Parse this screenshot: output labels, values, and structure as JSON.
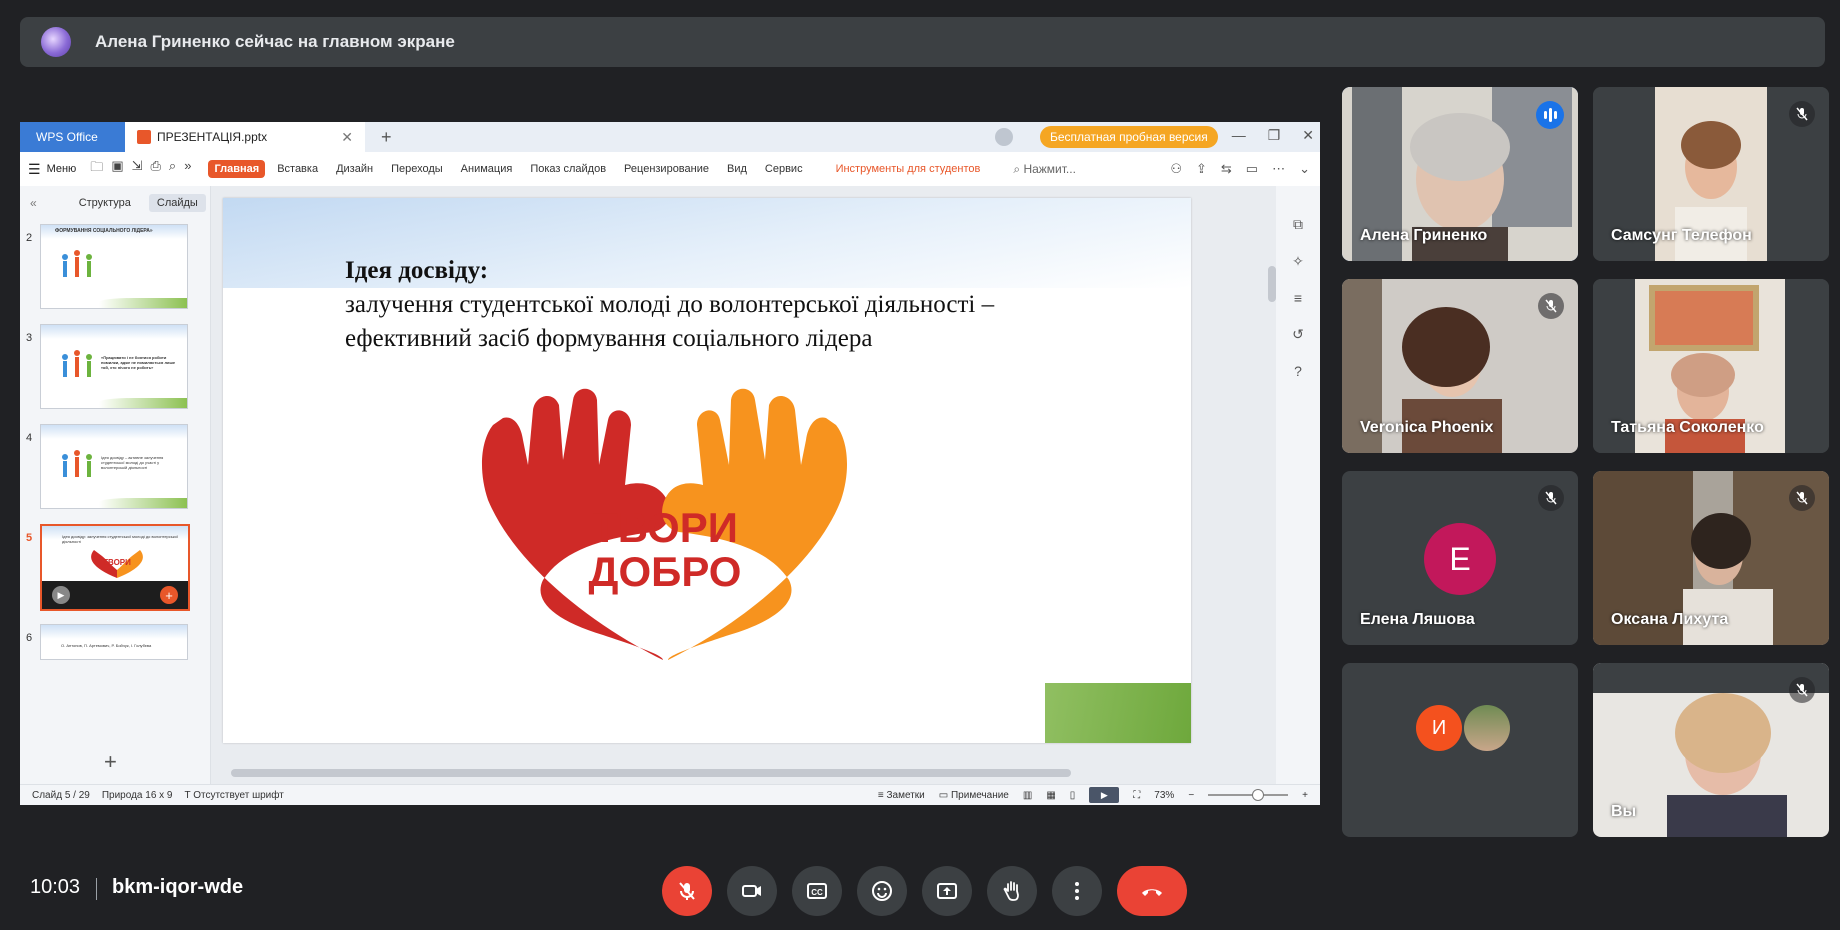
{
  "banner": {
    "text": "Алена Гриненко сейчас на главном экране"
  },
  "wps": {
    "tabs": {
      "office": "WPS Office",
      "document": "ПРЕЗЕНТАЦIЯ.pptx"
    },
    "trial_button": "Бесплатная пробная версия",
    "menu_label": "Меню",
    "ribbon_tabs": [
      "Главная",
      "Вставка",
      "Дизайн",
      "Переходы",
      "Анимация",
      "Показ слайдов",
      "Рецензирование",
      "Вид",
      "Сервис"
    ],
    "students_tools": "Инструменты для студентов",
    "search_placeholder": "Нажмит...",
    "panel_tabs": {
      "structure": "Структура",
      "slides": "Слайды"
    },
    "thumbnails": [
      {
        "num": "2",
        "text": "ФОРМУВАННЯ СОЦІАЛЬНОГО ЛІДЕРА»"
      },
      {
        "num": "3",
        "text": "«Працювати і не боятися робити помилки, адже не помиляється лише той, хто нічого не робить»"
      },
      {
        "num": "4",
        "text": "Ідея досвіду – активне залучення студентської молоді до участі у волонтерській діяльності"
      },
      {
        "num": "5",
        "text": "Ідея досвіду: залучення студентської молоді до волонтерської діяльності"
      },
      {
        "num": "6",
        "text": "О. Антонов, П. Артемович, Р. Бойчук, І. Голубєва"
      }
    ],
    "slide": {
      "heading": "Ідея досвіду:",
      "line1": "залучення студентської молоді до волонтерської діяльності –",
      "line2": "ефективний засіб формування соціального лідера",
      "logo_line1": "ТВОРИ",
      "logo_line2": "ДОБРО"
    },
    "status": {
      "slide_counter": "Слайд 5 / 29",
      "theme": "Природа 16 x 9",
      "missing_font": "Отсутствует шрифт",
      "notes": "Заметки",
      "comment": "Примечание",
      "zoom": "73%"
    }
  },
  "participants": [
    {
      "name": "Алена Гриненко",
      "state": "speaking"
    },
    {
      "name": "Самсунг Телефон",
      "state": "muted"
    },
    {
      "name": "Veronica Phoenix",
      "state": "muted"
    },
    {
      "name": "Татьяна Соколенко",
      "state": "muted"
    },
    {
      "name": "Елена Ляшова",
      "state": "muted",
      "avatar_letter": "Е"
    },
    {
      "name": "Оксана Лихута",
      "state": "muted"
    },
    {
      "name": "",
      "state": "group",
      "avatar_letter": "И"
    },
    {
      "name": "Вы",
      "state": "muted"
    }
  ],
  "footer": {
    "time": "10:03",
    "meeting_code": "bkm-iqor-wde"
  },
  "colors": {
    "accent": "#e8572a",
    "end_call": "#ea4335",
    "speaking": "#8ab4f8"
  }
}
